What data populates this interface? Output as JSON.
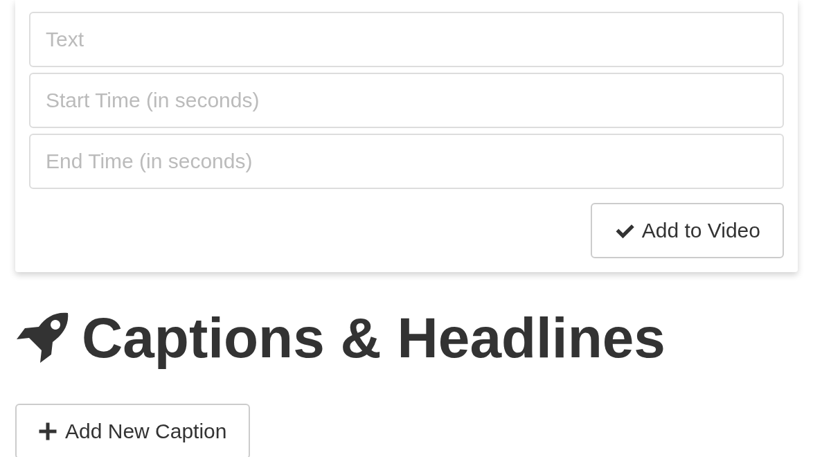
{
  "form": {
    "fields": [
      {
        "placeholder": "Text"
      },
      {
        "placeholder": "Start Time (in seconds)"
      },
      {
        "placeholder": "End Time (in seconds)"
      }
    ],
    "submit_button": "Add to Video"
  },
  "heading": "Captions & Headlines",
  "add_button": "Add New Caption"
}
